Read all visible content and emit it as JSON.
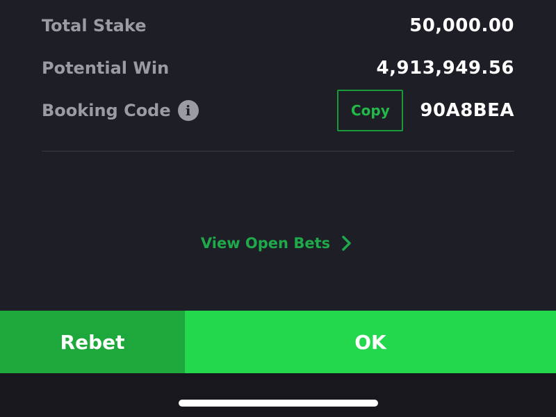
{
  "summary": {
    "total_stake_label": "Total Stake",
    "total_stake_value": "50,000.00",
    "potential_win_label": "Potential Win",
    "potential_win_value": "4,913,949.56",
    "booking_code_label": "Booking Code",
    "booking_code_value": "90A8BEA",
    "copy_label": "Copy"
  },
  "icons": {
    "info": "info-icon",
    "chevron": "chevron-right-icon"
  },
  "links": {
    "view_open_bets": "View Open Bets"
  },
  "actions": {
    "rebet_label": "Rebet",
    "ok_label": "OK"
  },
  "colors": {
    "background": "#1e1e27",
    "accent_green": "#23d84d",
    "rebet_green": "#1ea83b",
    "link_green": "#1fa94a",
    "label_gray": "#9b9ba3"
  }
}
